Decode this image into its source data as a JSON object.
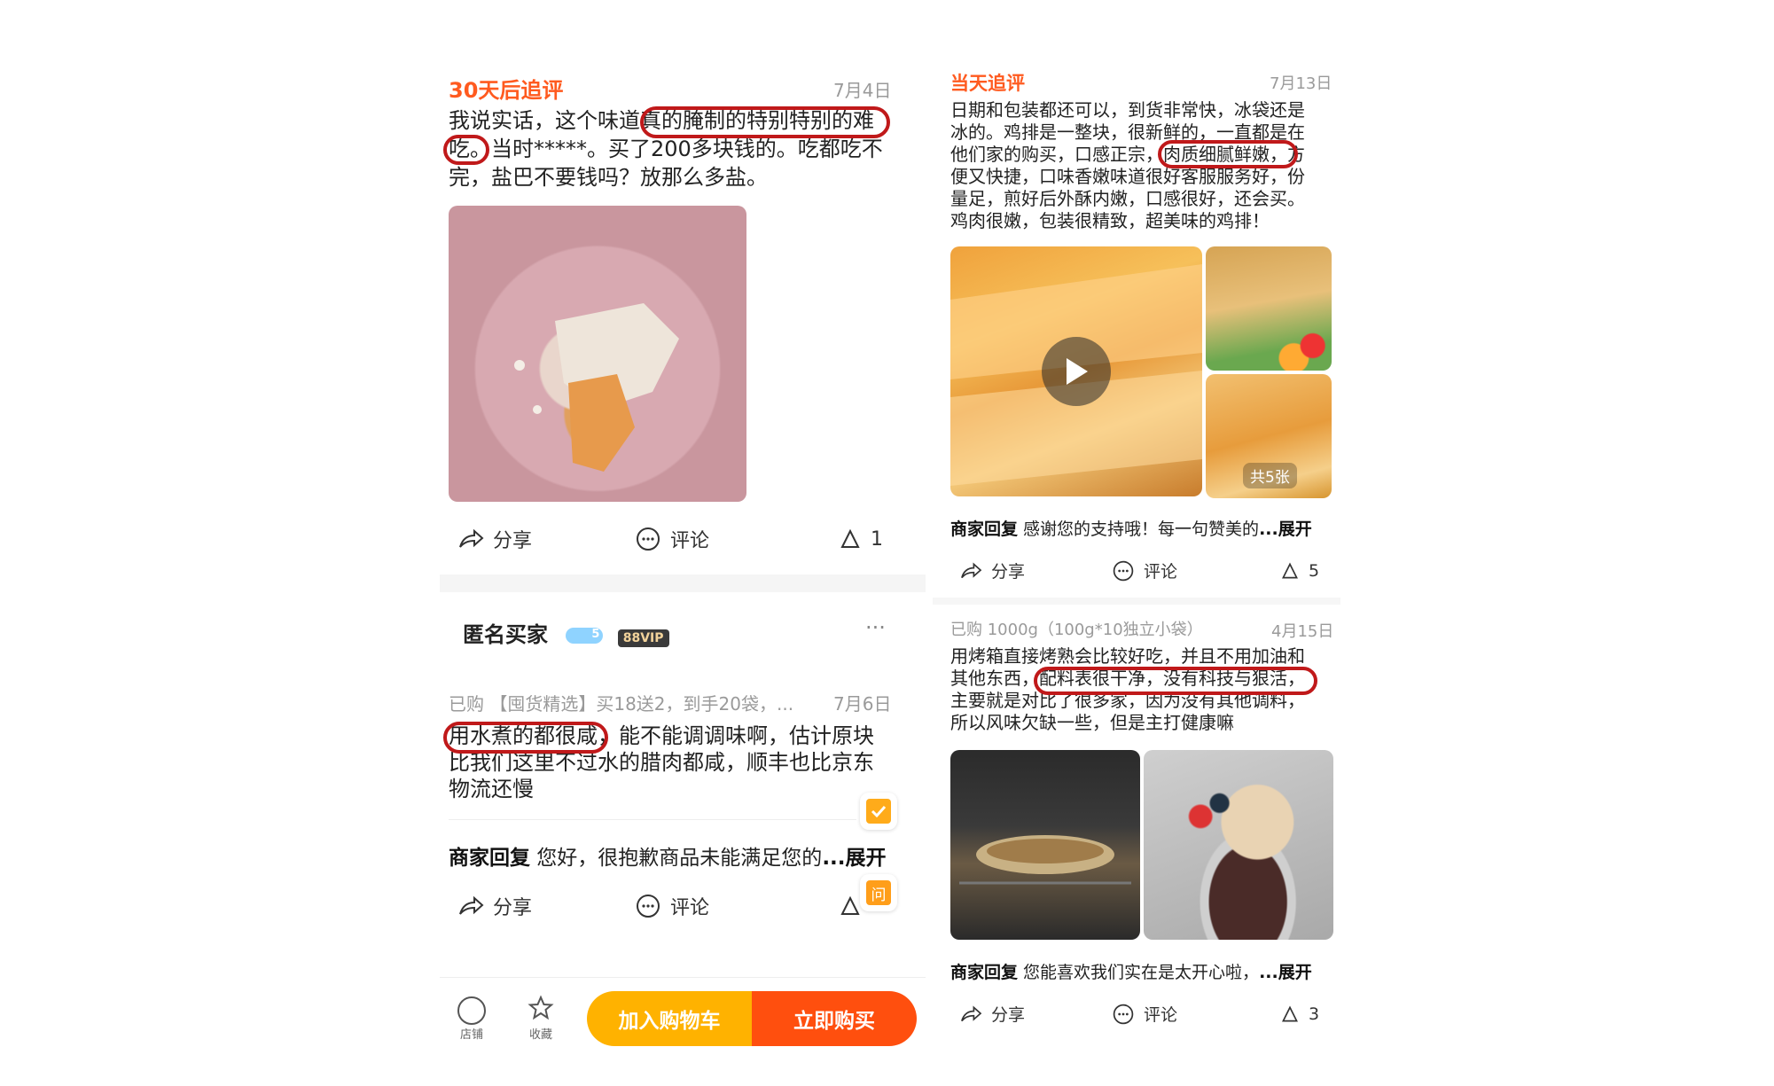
{
  "left": {
    "review1": {
      "title": "30天后追评",
      "date": "7月4日",
      "body_lines": [
        "我说实话，这个味道真的腌制的特别特别的难",
        "吃。当时*****。买了200多块钱的。吃都吃不",
        "完，盐巴不要钱吗？放那么多盐。"
      ],
      "actions": {
        "share": "分享",
        "comment": "评论",
        "like_count": "1"
      }
    },
    "reviewer": {
      "name": "匿名买家",
      "level": "5",
      "vip": "88VIP",
      "more": "···"
    },
    "review2": {
      "purchase": "已购 【囤货精选】买18送2，到手20袋，...",
      "date": "7月6日",
      "body_lines": [
        "用水煮的都很咸，能不能调调味啊，估计原块",
        "比我们这里不过水的腊肉都咸，顺丰也比京东",
        "物流还慢"
      ],
      "reply_label": "商家回复",
      "reply_text": " 您好，很抱歉商品未能满足您的",
      "reply_more": "...展开",
      "actions": {
        "share": "分享",
        "comment": "评论"
      },
      "float_ask": "问"
    },
    "bottom_bar": {
      "shop_label": "店铺",
      "fav_label": "收藏",
      "add_cart": "加入购物车",
      "buy_now": "立即购买"
    }
  },
  "right": {
    "review1": {
      "title": "当天追评",
      "date": "7月13日",
      "body_lines": [
        "日期和包装都还可以，到货非常快，冰袋还是",
        "冰的。鸡排是一整块，很新鲜的，一直都是在",
        "他们家的购买，口感正宗，肉质细腻鲜嫩，方",
        "便又快捷，口味香嫩味道很好客服服务好，份",
        "量足，煎好后外酥内嫩，口感很好，还会买。",
        "鸡肉很嫩，包装很精致，超美味的鸡排！"
      ],
      "image_count": "共5张",
      "reply_label": "商家回复",
      "reply_text": " 感谢您的支持哦！每一句赞美的",
      "reply_more": "...展开",
      "actions": {
        "share": "分享",
        "comment": "评论",
        "like_count": "5"
      }
    },
    "review2": {
      "purchase": "已购 1000g（100g*10独立小袋）",
      "date": "4月15日",
      "body_lines": [
        "用烤箱直接烤熟会比较好吃，并且不用加油和",
        "其他东西，配料表很干净，没有科技与狠活，",
        "主要就是对比了很多家，因为没有其他调料，",
        "所以风味欠缺一些，但是主打健康嘛"
      ],
      "reply_label": "商家回复",
      "reply_text": " 您能喜欢我们实在是太开心啦，",
      "reply_more": "...展开",
      "actions": {
        "share": "分享",
        "comment": "评论",
        "like_count": "3"
      }
    }
  },
  "colors": {
    "accent": "#ff5a1f",
    "highlight": "#c0191a",
    "cart": "#ffb200",
    "buy": "#ff4f0e"
  }
}
